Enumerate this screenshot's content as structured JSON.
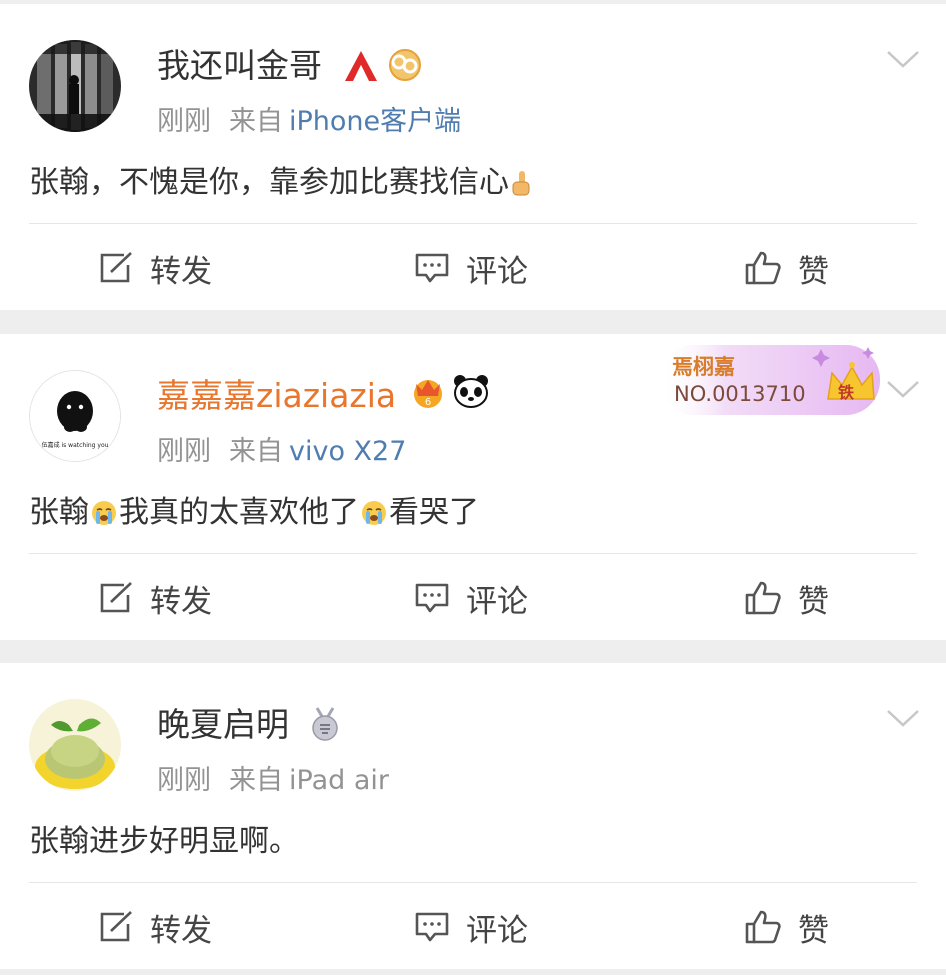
{
  "posts": [
    {
      "username": "我还叫金哥",
      "time": "刚刚",
      "source_label": "来自",
      "source": "iPhone客户端",
      "content": "张翰，不愧是你，靠参加比赛找信心",
      "badges": [
        "red-a-logo-icon",
        "golden-cloud-badge-icon"
      ],
      "avatar": "avatar-dark-interior",
      "actions": {
        "repost": "转发",
        "comment": "评论",
        "like": "赞"
      }
    },
    {
      "username": "嘉嘉嘉ziaziazia",
      "time": "刚刚",
      "source_label": "来自",
      "source": "vivo X27",
      "content_parts": [
        "张翰",
        "我真的太喜欢他了",
        "看哭了"
      ],
      "badges": [
        "crown-vip-badge-icon",
        "panda-badge-icon"
      ],
      "avatar": "avatar-black-blob",
      "avatar_caption": "伍嘉成 is watching you",
      "fan_card": {
        "name": "焉栩嘉",
        "number": "NO.0013710",
        "tier": "铁"
      },
      "actions": {
        "repost": "转发",
        "comment": "评论",
        "like": "赞"
      }
    },
    {
      "username": "晚夏启明",
      "time": "刚刚",
      "source_label": "来自",
      "source": "iPad air",
      "content": "张翰进步好明显啊。",
      "badges": [
        "medal-badge-icon"
      ],
      "avatar": "avatar-green-ice-cream",
      "actions": {
        "repost": "转发",
        "comment": "评论",
        "like": "赞"
      }
    }
  ],
  "colors": {
    "vip_name": "#e8762d",
    "source_link": "#507daf",
    "meta_gray": "#939393",
    "divider": "#e6e6e6",
    "background": "#eeeeee"
  }
}
